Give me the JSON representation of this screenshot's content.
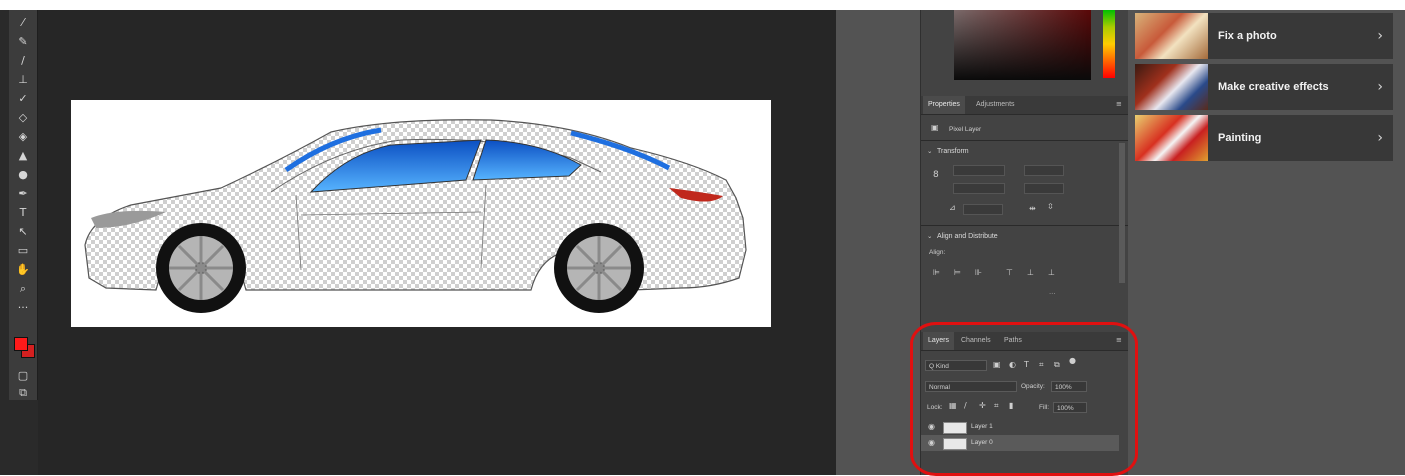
{
  "toolbar": {
    "tools": [
      "eyedropper-icon",
      "healing-brush-icon",
      "brush-icon",
      "stamp-icon",
      "history-brush-icon",
      "eraser-icon",
      "paint-bucket-icon",
      "blur-icon",
      "dodge-icon",
      "pen-icon",
      "type-icon",
      "path-select-icon",
      "rectangle-icon",
      "hand-icon",
      "zoom-icon",
      "more-tools-icon"
    ],
    "tool_glyphs": [
      "⁄",
      "✎",
      "/",
      "⊥",
      "✓",
      "◇",
      "◈",
      "▲",
      "●",
      "✒",
      "T",
      "↖",
      "▭",
      "✋",
      "⌕",
      "···"
    ],
    "fg_color": "#ff1a1a",
    "bg_color": "#d42020"
  },
  "properties": {
    "tabs": [
      "Properties",
      "Adjustments"
    ],
    "pixel_layer_label": "Pixel Layer",
    "transform_heading": "Transform",
    "align_heading": "Align and Distribute",
    "align_sub": "Align:",
    "more": "···"
  },
  "layers": {
    "tabs": [
      "Layers",
      "Channels",
      "Paths"
    ],
    "filter_label": "Q Kind",
    "blend_mode": "Normal",
    "opacity_label": "Opacity:",
    "opacity_value": "100%",
    "lock_label": "Lock:",
    "fill_label": "Fill:",
    "fill_value": "100%",
    "rows": [
      {
        "name": "Layer 1"
      },
      {
        "name": "Layer 0"
      }
    ]
  },
  "learn": {
    "cards": [
      {
        "label": "Fix a photo"
      },
      {
        "label": "Make creative effects"
      },
      {
        "label": "Painting"
      }
    ]
  },
  "colors": {
    "annotation": "#e01010",
    "window_glass": "#1e6fe0"
  }
}
